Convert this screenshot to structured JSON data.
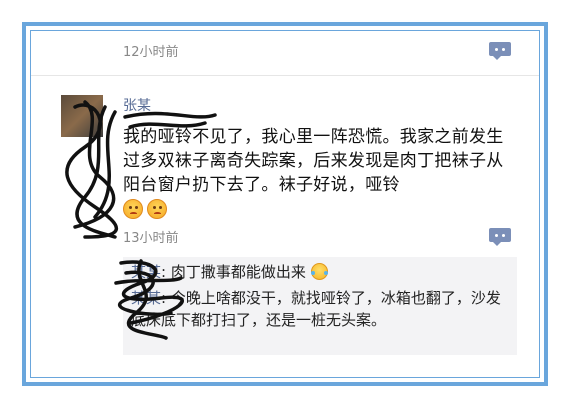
{
  "feed": {
    "top_timestamp": "12小时前",
    "post": {
      "author": "张某",
      "text": "我的哑铃不见了，我心里一阵恐慌。我家之前发生过多双袜子离奇失踪案，后来发现是肉丁把袜子从阳台窗户扔下去了。袜子好说，哑铃",
      "emojis": [
        "sad-face-emoji",
        "sad-face-emoji"
      ]
    },
    "bottom_timestamp": "13小时前",
    "reply": {
      "author_prefix": "某某",
      "line1": ": 肉丁撒事都能做出来",
      "line1_emoji": "laughing-tears-emoji",
      "line2_prefix": "某某",
      "line2": ": 今晚上啥都没干，就找哑铃了，冰箱也翻了，沙发底床底下都打扫了，还是一桩无头案。"
    }
  },
  "colors": {
    "frame": "#6aa6dc",
    "link_name": "#576b95",
    "comment_icon": "#7b8fb8",
    "timestamp": "#888888"
  },
  "icons": [
    "comment-icon"
  ]
}
